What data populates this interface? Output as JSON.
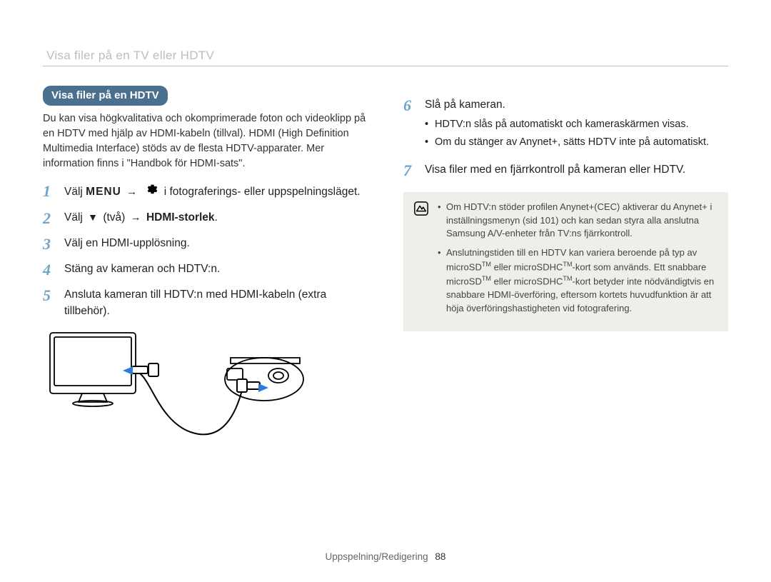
{
  "running_head": "Visa filer på en TV eller HDTV",
  "pill_heading": "Visa filer på en HDTV",
  "intro": "Du kan visa högkvalitativa och okomprimerade foton och videoklipp på en HDTV med hjälp av HDMI-kabeln (tillval). HDMI (High Definition Multimedia Interface) stöds av de flesta HDTV-apparater. Mer information finns i \"Handbok för HDMI-sats\".",
  "steps": {
    "s1_pre": "Välj ",
    "s1_menu": "MENU",
    "s1_post": " i fotograferings- eller uppspelningsläget.",
    "s2_pre": "Välj ",
    "s2_mid": " (två) ",
    "s2_bold": "HDMI-storlek",
    "s2_end": ".",
    "s3": "Välj en HDMI-upplösning.",
    "s4": "Stäng av kameran och HDTV:n.",
    "s5": "Ansluta kameran till HDTV:n med HDMI-kabeln (extra tillbehör).",
    "s6": "Slå på kameran.",
    "s6_b1": "HDTV:n slås på automatiskt och kameraskärmen visas.",
    "s6_b2": "Om du stänger av Anynet+, sätts HDTV inte på automatiskt.",
    "s7": "Visa filer med en fjärrkontroll på kameran eller HDTV."
  },
  "arrow": "→",
  "down": "▼",
  "note": {
    "b1": "Om HDTV:n stöder profilen Anynet+(CEC) aktiverar du Anynet+ i inställningsmenyn (sid 101) och kan sedan styra alla anslutna Samsung A/V-enheter från TV:ns fjärrkontroll.",
    "b2_pre": "Anslutningstiden till en HDTV kan variera beroende på typ av microSD",
    "b2_mid": " eller microSDHC",
    "b2_post": "-kort som används. Ett snabbare microSD",
    "b2_mid2": " eller microSDHC",
    "b2_end": "-kort betyder inte nödvändigtvis en snabbare HDMI-överföring, eftersom kortets huvudfunktion är att höja överföringshastigheten vid fotografering.",
    "tm": "TM"
  },
  "footer_label": "Uppspelning/Redigering",
  "page_number": "88"
}
